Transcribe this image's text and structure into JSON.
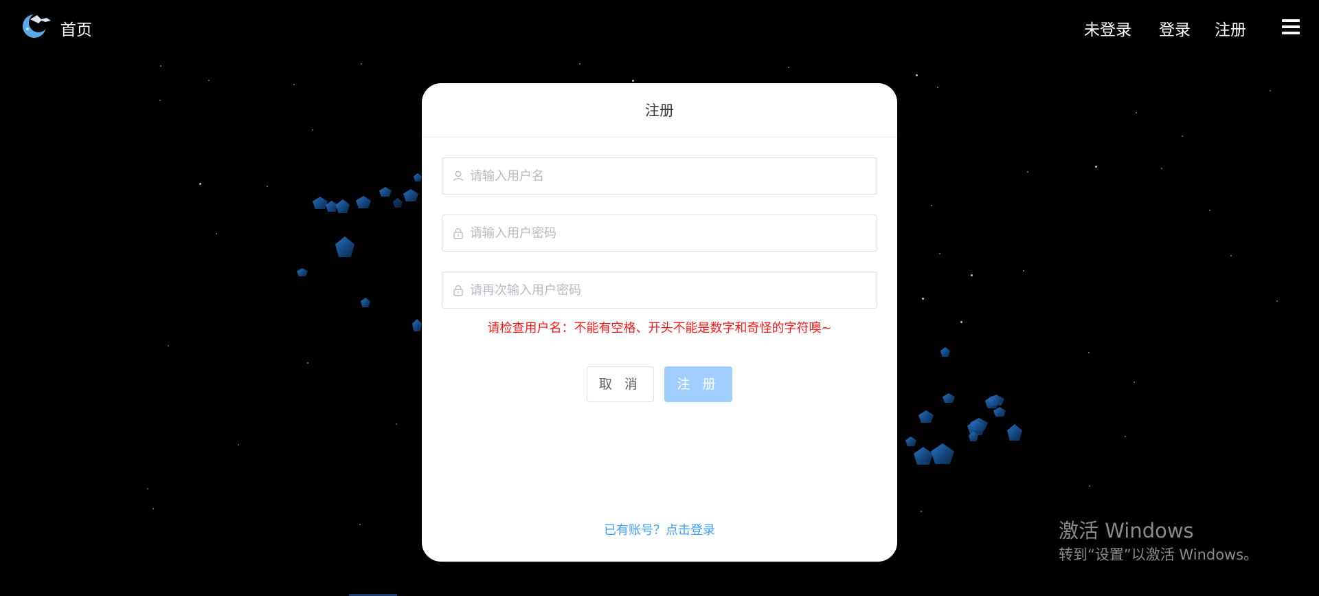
{
  "header": {
    "brand_label": "首页",
    "status_label": "未登录",
    "login_label": "登录",
    "register_label": "注册"
  },
  "dialog": {
    "title": "注册",
    "username_placeholder": "请输入用户名",
    "password_placeholder": "请输入用户密码",
    "confirm_placeholder": "请再次输入用户密码",
    "error_message": "请检查用户名：不能有空格、开头不能是数字和奇怪的字符噢~",
    "cancel_label": "取 消",
    "submit_label": "注 册",
    "login_link": "已有账号？点击登录"
  },
  "watermark": {
    "title": "激活 Windows",
    "subtitle": "转到“设置”以激活 Windows。"
  },
  "colors": {
    "background": "#000000",
    "accent": "#409eff",
    "submit_disabled": "#a0cfff",
    "error": "#ff1a1a",
    "crystal": "#2c7fd6"
  },
  "icons": {
    "logo": "moon-logo-icon",
    "menu": "hamburger-menu-icon",
    "username": "user-icon",
    "password": "lock-icon"
  }
}
